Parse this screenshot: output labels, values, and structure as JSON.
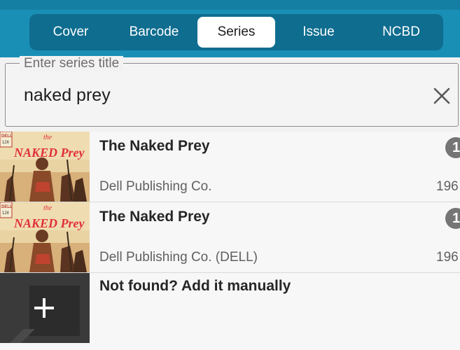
{
  "tabs": [
    {
      "label": "Cover",
      "active": false
    },
    {
      "label": "Barcode",
      "active": false
    },
    {
      "label": "Series",
      "active": true
    },
    {
      "label": "Issue",
      "active": false
    },
    {
      "label": "NCBD",
      "active": false
    }
  ],
  "search": {
    "legend": "Enter series title",
    "value": "naked prey",
    "clear_icon": "close-icon"
  },
  "results": [
    {
      "title": "The Naked Prey",
      "publisher": "Dell Publishing Co.",
      "year": "196",
      "count": "1",
      "cover_brand": "DELL",
      "cover_price": "12¢",
      "cover_title_line1": "the",
      "cover_title_line2": "NAKED Prey"
    },
    {
      "title": "The Naked Prey",
      "publisher": "Dell Publishing Co. (DELL)",
      "year": "196",
      "count": "1",
      "cover_brand": "DELL",
      "cover_price": "12¢",
      "cover_title_line1": "the",
      "cover_title_line2": "NAKED Prey"
    }
  ],
  "add_manual": {
    "label": "Not found? Add it manually",
    "icon": "plus-icon"
  },
  "colors": {
    "accent": "#1a8fb6",
    "segment": "#0f6d8f",
    "cover_title": "#e0303a"
  }
}
